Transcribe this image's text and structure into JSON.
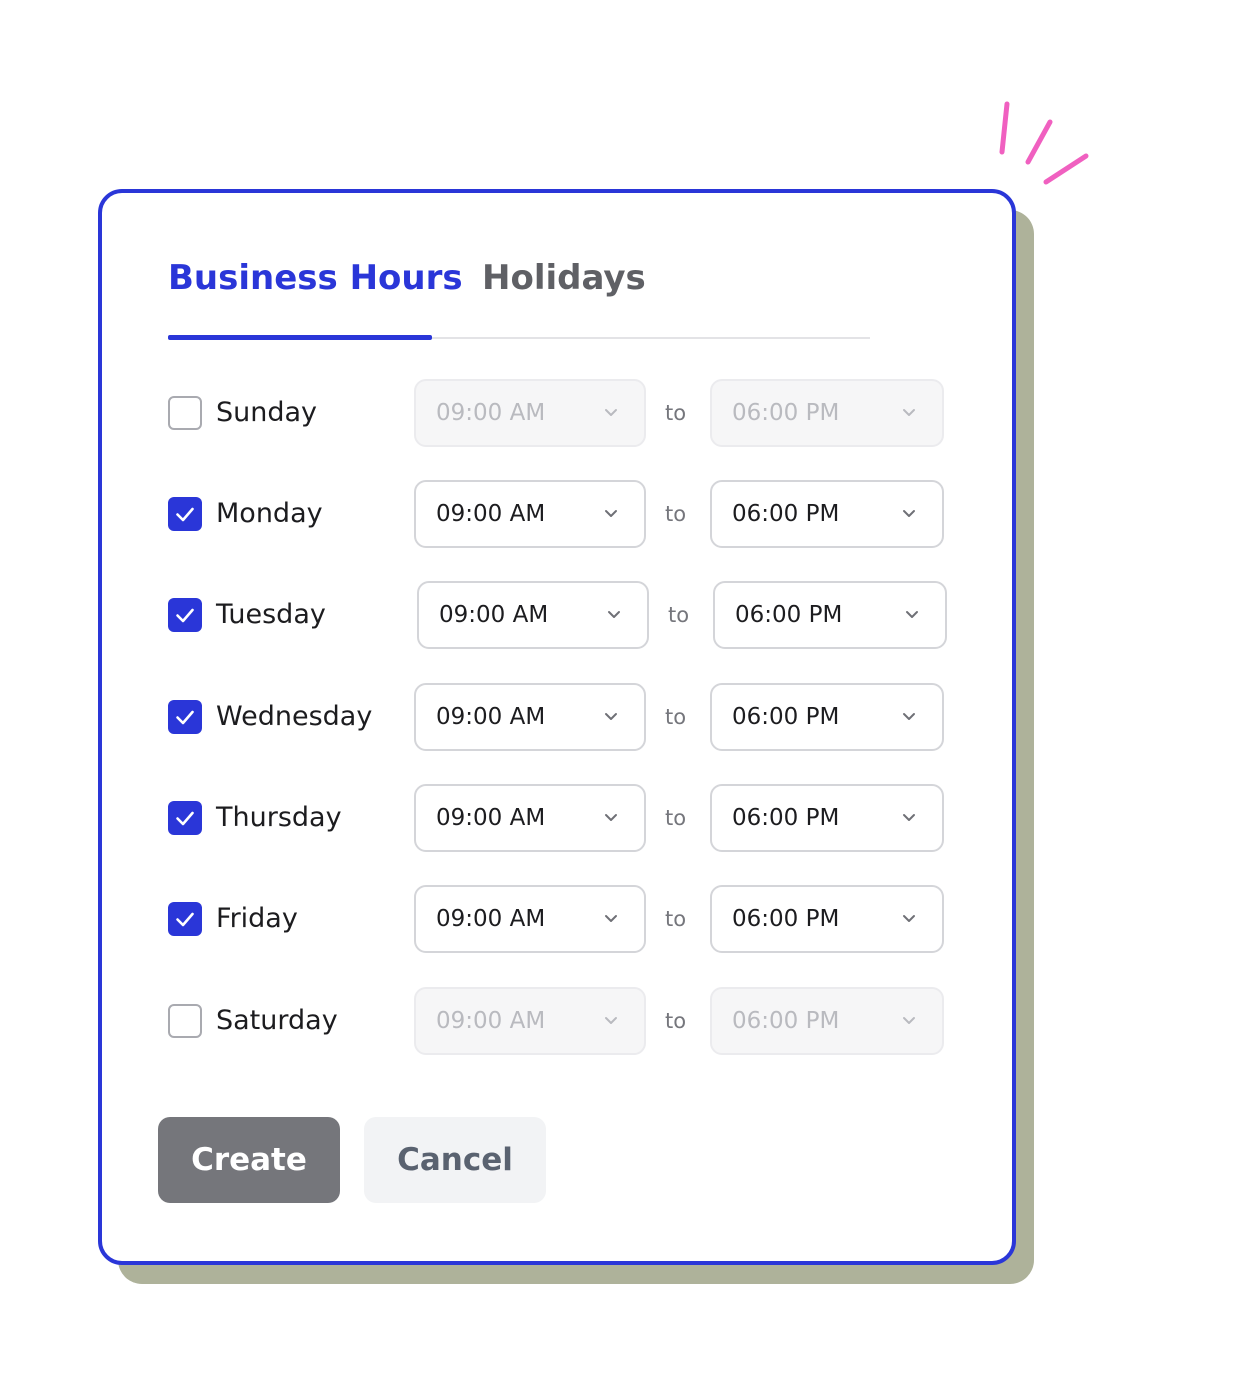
{
  "tabs": [
    {
      "label": "Business Hours",
      "active": true
    },
    {
      "label": "Holidays",
      "active": false
    }
  ],
  "connector": "to",
  "days": [
    {
      "label": "Sunday",
      "checked": false,
      "from": "09:00 AM",
      "to": "06:00 PM"
    },
    {
      "label": "Monday",
      "checked": true,
      "from": "09:00 AM",
      "to": "06:00 PM"
    },
    {
      "label": "Tuesday",
      "checked": true,
      "from": "09:00 AM",
      "to": "06:00 PM"
    },
    {
      "label": "Wednesday",
      "checked": true,
      "from": "09:00 AM",
      "to": "06:00 PM"
    },
    {
      "label": "Thursday",
      "checked": true,
      "from": "09:00 AM",
      "to": "06:00 PM"
    },
    {
      "label": "Friday",
      "checked": true,
      "from": "09:00 AM",
      "to": "06:00 PM"
    },
    {
      "label": "Saturday",
      "checked": false,
      "from": "09:00 AM",
      "to": "06:00 PM"
    }
  ],
  "actions": {
    "create_label": "Create",
    "cancel_label": "Cancel"
  },
  "colors": {
    "accent": "#2a36d8",
    "card_shadow": "#aeb29a",
    "sparkle": "#f060c0",
    "create_button": "#75767b"
  },
  "icons": {
    "checkbox_check": "check-icon",
    "select_arrow": "chevron-down-icon",
    "decoration": "sparkle-icon"
  }
}
